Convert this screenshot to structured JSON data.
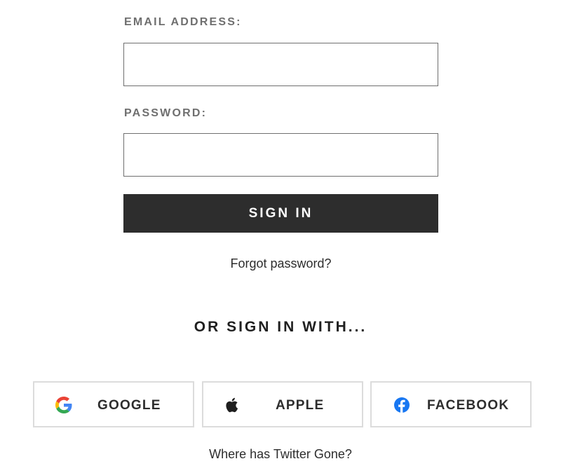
{
  "login_form": {
    "email_label": "EMAIL ADDRESS:",
    "email_value": "",
    "password_label": "PASSWORD:",
    "password_value": "",
    "sign_in_label": "SIGN IN",
    "forgot_password_label": "Forgot password?"
  },
  "social": {
    "heading": "OR SIGN IN WITH...",
    "providers": [
      {
        "label": "GOOGLE",
        "icon": "google-icon"
      },
      {
        "label": "APPLE",
        "icon": "apple-icon"
      },
      {
        "label": "FACEBOOK",
        "icon": "facebook-icon"
      }
    ],
    "twitter_link": "Where has Twitter Gone?"
  },
  "colors": {
    "primary_button": "#2d2d2d",
    "label_gray": "#6f6f6f",
    "social_border": "#dcdcdc",
    "facebook_blue": "#1877f2"
  }
}
